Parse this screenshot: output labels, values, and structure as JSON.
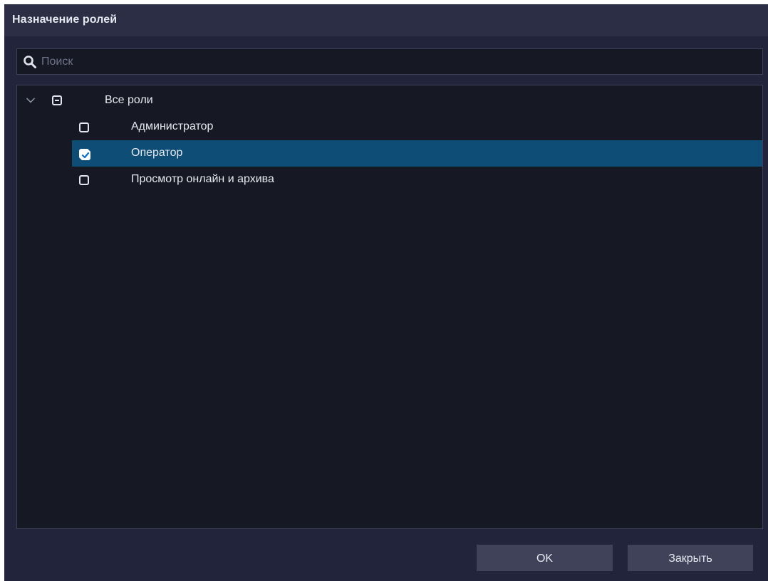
{
  "dialog": {
    "title": "Назначение ролей"
  },
  "search": {
    "placeholder": "Поиск",
    "value": ""
  },
  "tree": {
    "root": {
      "label": "Все роли",
      "state": "partial",
      "expanded": true
    },
    "items": [
      {
        "label": "Администратор",
        "checked": false,
        "selected": false
      },
      {
        "label": "Оператор",
        "checked": true,
        "selected": true
      },
      {
        "label": "Просмотр онлайн и архива",
        "checked": false,
        "selected": false
      }
    ]
  },
  "buttons": {
    "ok_label": "OK",
    "close_label": "Закрыть"
  },
  "colors": {
    "dialog_bg": "#21243a",
    "titlebar_bg": "#2b2e44",
    "panel_bg": "#161824",
    "selection": "#0e4d75",
    "checkbox_check": "#0a6fd0",
    "button_bg": "#3f4258"
  },
  "icons": {
    "search": "search-icon",
    "expand": "chevron-down-icon"
  }
}
